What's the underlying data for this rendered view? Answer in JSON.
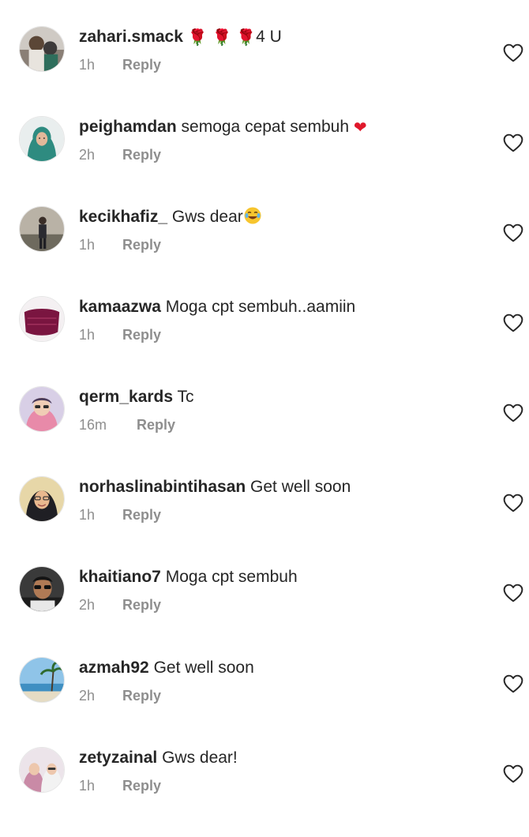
{
  "comments": [
    {
      "username": "zahari.smack",
      "text": "4 U",
      "time": "1h",
      "reply_label": "Reply",
      "leading_emojis": [
        "🌹",
        "🌹",
        "🌹"
      ],
      "trailing_emoji": ""
    },
    {
      "username": "peighamdan",
      "text": "semoga cepat sembuh",
      "time": "2h",
      "reply_label": "Reply",
      "leading_emojis": [],
      "trailing_emoji": "❤"
    },
    {
      "username": "kecikhafiz_",
      "text": "Gws dear",
      "time": "1h",
      "reply_label": "Reply",
      "leading_emojis": [],
      "trailing_emoji": "😂"
    },
    {
      "username": "kamaazwa",
      "text": "Moga cpt sembuh..aamiin",
      "time": "1h",
      "reply_label": "Reply",
      "leading_emojis": [],
      "trailing_emoji": ""
    },
    {
      "username": "qerm_kards",
      "text": "Tc",
      "time": "16m",
      "reply_label": "Reply",
      "leading_emojis": [],
      "trailing_emoji": ""
    },
    {
      "username": "norhaslinabintihasan",
      "text": "Get well soon",
      "time": "1h",
      "reply_label": "Reply",
      "leading_emojis": [],
      "trailing_emoji": ""
    },
    {
      "username": "khaitiano7",
      "text": "Moga cpt sembuh",
      "time": "2h",
      "reply_label": "Reply",
      "leading_emojis": [],
      "trailing_emoji": ""
    },
    {
      "username": "azmah92",
      "text": "Get well soon",
      "time": "2h",
      "reply_label": "Reply",
      "leading_emojis": [],
      "trailing_emoji": ""
    },
    {
      "username": "zetyzainal",
      "text": "Gws dear!",
      "time": "1h",
      "reply_label": "Reply",
      "leading_emojis": [],
      "trailing_emoji": ""
    }
  ],
  "icons": {
    "like": "heart-outline-icon",
    "rose": "rose-emoji",
    "red_heart": "red-heart-emoji",
    "laughing": "tears-of-joy-emoji"
  },
  "colors": {
    "text_primary": "#262626",
    "text_secondary": "#8e8e8e",
    "emoji_red": "#e0182b"
  }
}
